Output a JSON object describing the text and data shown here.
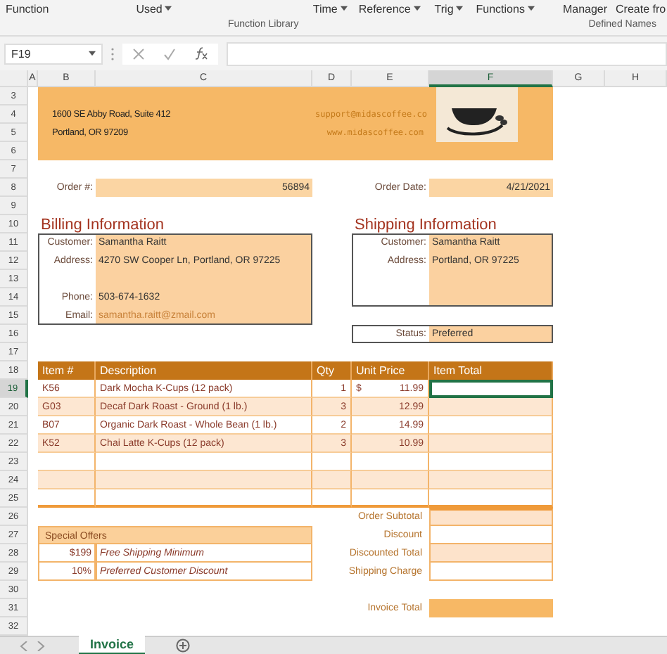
{
  "ribbon": {
    "commands": [
      {
        "label": "Function",
        "dropdown": false
      },
      {
        "label": "Used",
        "dropdown": true
      },
      {
        "label": "Time",
        "dropdown": true
      },
      {
        "label": "Reference",
        "dropdown": true
      },
      {
        "label": "Trig",
        "dropdown": true
      },
      {
        "label": "Functions",
        "dropdown": true
      },
      {
        "label": "Manager",
        "dropdown": false
      },
      {
        "label": "Create fro",
        "dropdown": false
      }
    ],
    "groups": [
      "Function Library",
      "Defined Names"
    ]
  },
  "formula_bar": {
    "name_box": "F19"
  },
  "column_headers": [
    {
      "label": "A",
      "selected": false
    },
    {
      "label": "B",
      "selected": false
    },
    {
      "label": "C",
      "selected": false
    },
    {
      "label": "D",
      "selected": false
    },
    {
      "label": "E",
      "selected": false
    },
    {
      "label": "F",
      "selected": true
    },
    {
      "label": "G",
      "selected": false
    },
    {
      "label": "H",
      "selected": false
    }
  ],
  "row_numbers": [
    {
      "label": "3",
      "selected": false
    },
    {
      "label": "4",
      "selected": false
    },
    {
      "label": "5",
      "selected": false
    },
    {
      "label": "6",
      "selected": false
    },
    {
      "label": "7",
      "selected": false
    },
    {
      "label": "8",
      "selected": false
    },
    {
      "label": "9",
      "selected": false
    },
    {
      "label": "10",
      "selected": false
    },
    {
      "label": "11",
      "selected": false
    },
    {
      "label": "12",
      "selected": false
    },
    {
      "label": "13",
      "selected": false
    },
    {
      "label": "14",
      "selected": false
    },
    {
      "label": "15",
      "selected": false
    },
    {
      "label": "16",
      "selected": false
    },
    {
      "label": "17",
      "selected": false
    },
    {
      "label": "18",
      "selected": false
    },
    {
      "label": "19",
      "selected": true
    },
    {
      "label": "20",
      "selected": false
    },
    {
      "label": "21",
      "selected": false
    },
    {
      "label": "22",
      "selected": false
    },
    {
      "label": "23",
      "selected": false
    },
    {
      "label": "24",
      "selected": false
    },
    {
      "label": "25",
      "selected": false
    },
    {
      "label": "26",
      "selected": false
    },
    {
      "label": "27",
      "selected": false
    },
    {
      "label": "28",
      "selected": false
    },
    {
      "label": "29",
      "selected": false
    },
    {
      "label": "30",
      "selected": false
    },
    {
      "label": "31",
      "selected": false
    },
    {
      "label": "32",
      "selected": false
    }
  ],
  "company": {
    "address_lines": [
      "1600 SE Abby Road, Suite 412",
      "Portland, OR 97209"
    ],
    "email": "support@midascoffee.co",
    "website": "www.midascoffee.com"
  },
  "order": {
    "number_label": "Order #:",
    "number": "56894",
    "date_label": "Order Date:",
    "date": "4/21/2021"
  },
  "billing": {
    "title": "Billing Information",
    "fields": [
      {
        "label": "Customer:",
        "value": "Samantha Raitt",
        "kind": "text"
      },
      {
        "label": "Address:",
        "value": "4270 SW Cooper Ln, Portland, OR 97225",
        "kind": "text"
      },
      {
        "label": "Phone:",
        "value": "503-674-1632",
        "kind": "text"
      },
      {
        "label": "Email:",
        "value": "samantha.raitt@zmail.com",
        "kind": "link"
      }
    ]
  },
  "shipping": {
    "title": "Shipping Information",
    "fields": [
      {
        "label": "Customer:",
        "value": "Samantha Raitt"
      },
      {
        "label": "Address:",
        "value": "Portland, OR 97225"
      }
    ],
    "status_label": "Status:",
    "status": "Preferred"
  },
  "items": {
    "columns": [
      "Item #",
      "Description",
      "Qty",
      "Unit Price",
      "Item Total"
    ],
    "rows": [
      {
        "item": "K56",
        "description": "Dark Mocha K-Cups (12 pack)",
        "qty": "1",
        "currency": "$",
        "unit_price": "11.99",
        "selected": true
      },
      {
        "item": "G03",
        "description": "Decaf Dark Roast - Ground (1 lb.)",
        "qty": "3",
        "unit_price": "12.99",
        "selected": false
      },
      {
        "item": "B07",
        "description": "Organic Dark Roast - Whole Bean (1 lb.)",
        "qty": "2",
        "unit_price": "14.99",
        "selected": false
      },
      {
        "item": "K52",
        "description": "Chai Latte K-Cups (12 pack)",
        "qty": "3",
        "unit_price": "10.99",
        "selected": false
      }
    ]
  },
  "special_offers": {
    "title": "Special Offers",
    "rows": [
      {
        "value": "$199",
        "text": "Free Shipping Minimum"
      },
      {
        "value": "10%",
        "text": "Preferred Customer Discount"
      }
    ]
  },
  "totals": [
    {
      "label": "Order Subtotal",
      "shaded": true
    },
    {
      "label": "Discount",
      "shaded": false
    },
    {
      "label": "Discounted Total",
      "shaded": true
    },
    {
      "label": "Shipping Charge",
      "shaded": false
    }
  ],
  "invoice_total_label": "Invoice Total",
  "sheet_tabs": [
    {
      "label": "Invoice",
      "selected": true
    }
  ]
}
